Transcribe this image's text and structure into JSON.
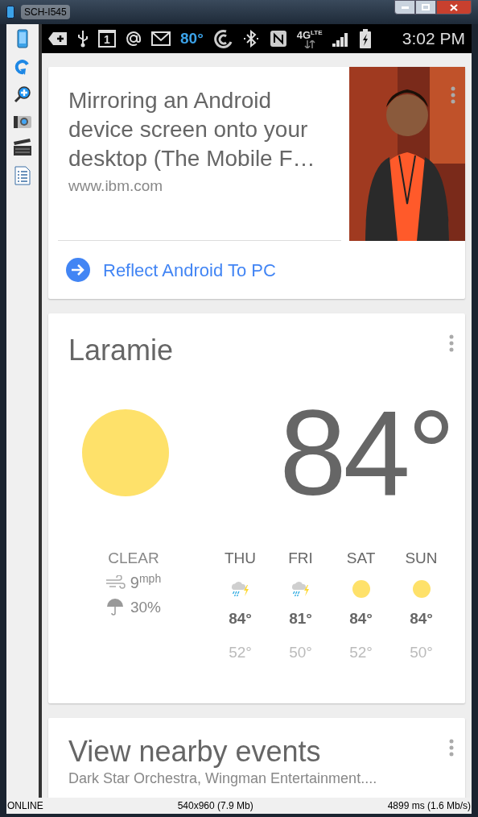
{
  "window": {
    "title": "SCH-I545"
  },
  "status_bar": {
    "calendar_day": "1",
    "temperature": "80°",
    "network": "4G",
    "network_sub": "LTE",
    "time": "3:02 PM"
  },
  "article_card": {
    "title": "Mirroring an Android device screen onto your desktop (The Mobile F…",
    "source": "www.ibm.com",
    "link": "Reflect Android To PC"
  },
  "weather_card": {
    "city": "Laramie",
    "temperature": "84°",
    "condition": "CLEAR",
    "wind": "9",
    "wind_unit": "mph",
    "precipitation": "30%",
    "forecast": [
      {
        "day": "THU",
        "kind": "storm",
        "high": "84°",
        "low": "52°"
      },
      {
        "day": "FRI",
        "kind": "storm",
        "high": "81°",
        "low": "50°"
      },
      {
        "day": "SAT",
        "kind": "sun",
        "high": "84°",
        "low": "52°"
      },
      {
        "day": "SUN",
        "kind": "sun",
        "high": "84°",
        "low": "50°"
      }
    ]
  },
  "events_card": {
    "title": "View nearby events",
    "subtitle": "Dark Star Orchestra, Wingman Entertainment...."
  },
  "footer": {
    "state": "ONLINE",
    "resolution": "540x960 (7.9 Mb)",
    "timing": "4899 ms (1.6 Mb/s)"
  }
}
